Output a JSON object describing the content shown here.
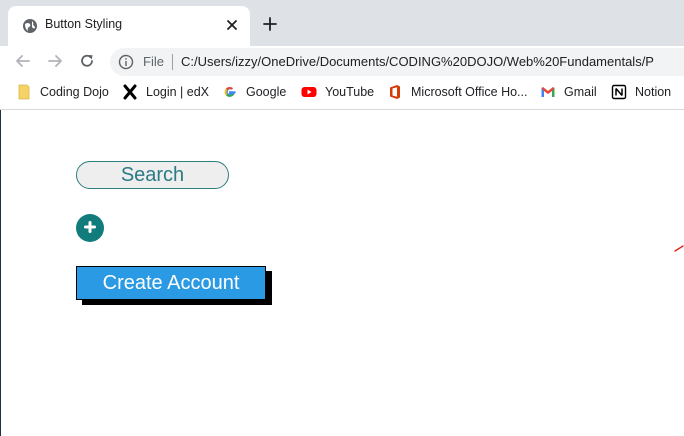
{
  "browser": {
    "tab": {
      "title": "Button Styling",
      "favicon": "globe-icon"
    },
    "address": {
      "scheme_label": "File",
      "url": "C:/Users/izzy/OneDrive/Documents/CODING%20DOJO/Web%20Fundamentals/P"
    },
    "bookmarks": [
      {
        "label": "Coding Dojo",
        "icon": "folder-icon",
        "color": "#f6d365"
      },
      {
        "label": "Login | edX",
        "icon": "edx-icon",
        "color": "#000000"
      },
      {
        "label": "Google",
        "icon": "google-icon",
        "color": "#4285f4"
      },
      {
        "label": "YouTube",
        "icon": "youtube-icon",
        "color": "#ff0000"
      },
      {
        "label": "Microsoft Office Ho...",
        "icon": "office-icon",
        "color": "#d83b01"
      },
      {
        "label": "Gmail",
        "icon": "gmail-icon",
        "color": "#ea4335"
      },
      {
        "label": "Notion",
        "icon": "notion-icon",
        "color": "#000000"
      }
    ]
  },
  "page": {
    "search_button": {
      "label": "Search"
    },
    "plus_button": {
      "icon": "plus-icon"
    },
    "create_account_button": {
      "label": "Create Account"
    }
  },
  "colors": {
    "teal": "#127c7d",
    "blue": "#2a9ae4",
    "search_text": "#2a7b84"
  }
}
